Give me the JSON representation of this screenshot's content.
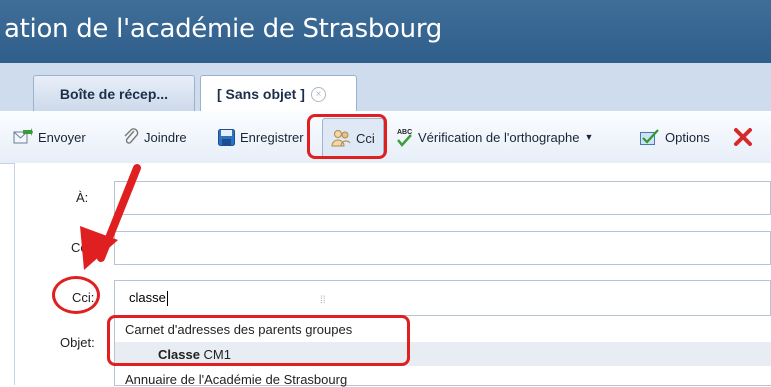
{
  "window": {
    "title": "ation de l'académie de Strasbourg"
  },
  "tabs": [
    {
      "label": "Boîte de récep..."
    },
    {
      "label": "[ Sans objet ]"
    }
  ],
  "toolbar": {
    "send": "Envoyer",
    "attach": "Joindre",
    "save": "Enregistrer",
    "bcc": "Cci",
    "spellcheck": "Vérification de l'orthographe",
    "options": "Options"
  },
  "form": {
    "to_label": "À:",
    "cc_label": "Cc",
    "bcc_label": "Cci:",
    "bcc_value": "classe",
    "subject_label": "Objet:"
  },
  "autocomplete": {
    "group1": "Carnet d'adresses des parents groupes",
    "item1_bold": "Classe",
    "item1_rest": " CM1",
    "group2": "Annuaire de l'Académie de Strasbourg"
  },
  "colors": {
    "highlight": "#e02020",
    "header": "#35638f",
    "tabbar": "#cfdced"
  }
}
